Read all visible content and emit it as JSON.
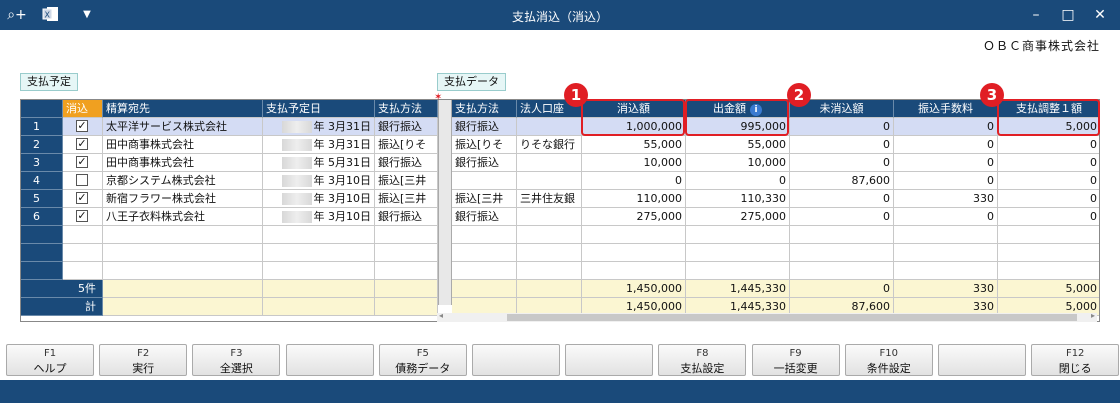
{
  "window": {
    "title": "支払消込（消込）"
  },
  "company": "ＯＢＣ商事株式会社",
  "sections": {
    "plan": "支払予定",
    "data": "支払データ"
  },
  "columns": {
    "keshikomi": "消込",
    "dest": "精算宛先",
    "due": "支払予定日",
    "method_left": "支払方法",
    "method": "支払方法",
    "account": "法人口座",
    "amount": "消込額",
    "paid": "出金額",
    "unpaid": "未消込額",
    "fee": "振込手数料",
    "adjust": "支払調整１額"
  },
  "rows": [
    {
      "no": "1",
      "checked": true,
      "dest": "太平洋サービス株式会社",
      "due": "年  3月31日",
      "method_left": "銀行振込",
      "method": "銀行振込",
      "account": "",
      "amount": "1,000,000",
      "paid": "995,000",
      "unpaid": "0",
      "fee": "0",
      "adjust": "5,000"
    },
    {
      "no": "2",
      "checked": true,
      "dest": "田中商事株式会社",
      "due": "年  3月31日",
      "method_left": "振込[りそ",
      "method": "振込[りそ",
      "account": "りそな銀行",
      "amount": "55,000",
      "paid": "55,000",
      "unpaid": "0",
      "fee": "0",
      "adjust": "0"
    },
    {
      "no": "3",
      "checked": true,
      "dest": "田中商事株式会社",
      "due": "年  5月31日",
      "method_left": "銀行振込",
      "method": "銀行振込",
      "account": "",
      "amount": "10,000",
      "paid": "10,000",
      "unpaid": "0",
      "fee": "0",
      "adjust": "0"
    },
    {
      "no": "4",
      "checked": false,
      "dest": "京都システム株式会社",
      "due": "年  3月10日",
      "method_left": "振込[三井",
      "method": "",
      "account": "",
      "amount": "0",
      "paid": "0",
      "unpaid": "87,600",
      "fee": "0",
      "adjust": "0"
    },
    {
      "no": "5",
      "checked": true,
      "dest": "新宿フラワー株式会社",
      "due": "年  3月10日",
      "method_left": "振込[三井",
      "method": "振込[三井",
      "account": "三井住友銀",
      "amount": "110,000",
      "paid": "110,330",
      "unpaid": "0",
      "fee": "330",
      "adjust": "0"
    },
    {
      "no": "6",
      "checked": true,
      "dest": "八王子衣料株式会社",
      "due": "年  3月10日",
      "method_left": "銀行振込",
      "method": "銀行振込",
      "account": "",
      "amount": "275,000",
      "paid": "275,000",
      "unpaid": "0",
      "fee": "0",
      "adjust": "0"
    }
  ],
  "totals": [
    {
      "label": "5件",
      "amount": "1,450,000",
      "paid": "1,445,330",
      "unpaid": "0",
      "fee": "330",
      "adjust": "5,000"
    },
    {
      "label": "計",
      "amount": "1,450,000",
      "paid": "1,445,330",
      "unpaid": "87,600",
      "fee": "330",
      "adjust": "5,000"
    }
  ],
  "badges": [
    "1",
    "2",
    "3"
  ],
  "fkeys": [
    {
      "key": "F1",
      "label": "ヘルプ"
    },
    {
      "key": "F2",
      "label": "実行"
    },
    {
      "key": "F3",
      "label": "全選択"
    },
    {
      "key": "",
      "label": ""
    },
    {
      "key": "F5",
      "label": "債務データ"
    },
    {
      "key": "",
      "label": ""
    },
    {
      "key": "",
      "label": ""
    },
    {
      "key": "F8",
      "label": "支払設定"
    },
    {
      "key": "F9",
      "label": "一括変更"
    },
    {
      "key": "F10",
      "label": "条件設定"
    },
    {
      "key": "",
      "label": ""
    },
    {
      "key": "F12",
      "label": "閉じる"
    }
  ],
  "icons": {
    "search": "search-plus-icon",
    "excel": "excel-icon",
    "menu": "dropdown-icon"
  }
}
